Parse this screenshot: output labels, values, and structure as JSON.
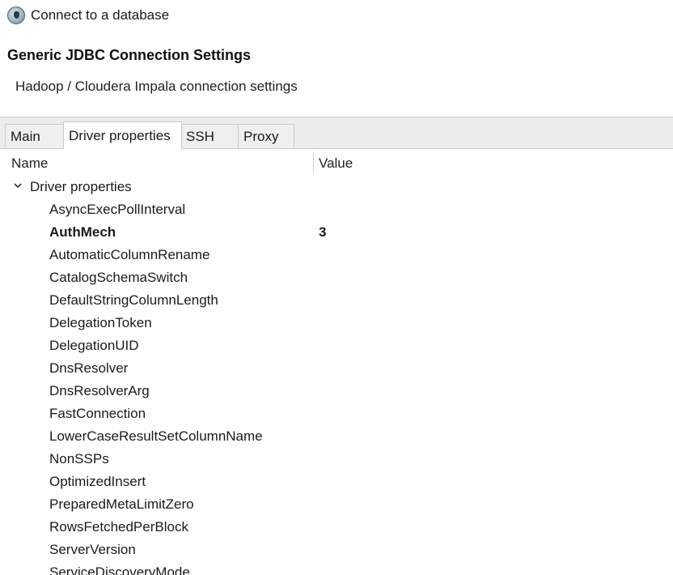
{
  "window": {
    "title": "Connect to a database",
    "icon": "database-connection-icon"
  },
  "header": {
    "title": "Generic JDBC Connection Settings",
    "subtitle": "Hadoop / Cloudera Impala connection settings"
  },
  "tabs": [
    {
      "label": "Main",
      "active": false
    },
    {
      "label": "Driver properties",
      "active": true
    },
    {
      "label": "SSH",
      "active": false
    },
    {
      "label": "Proxy",
      "active": false
    }
  ],
  "table": {
    "columns": {
      "name": "Name",
      "value": "Value"
    },
    "group": {
      "label": "Driver properties",
      "expanded": true
    },
    "rows": [
      {
        "name": "AsyncExecPollInterval",
        "value": ""
      },
      {
        "name": "AuthMech",
        "value": "3"
      },
      {
        "name": "AutomaticColumnRename",
        "value": ""
      },
      {
        "name": "CatalogSchemaSwitch",
        "value": ""
      },
      {
        "name": "DefaultStringColumnLength",
        "value": ""
      },
      {
        "name": "DelegationToken",
        "value": ""
      },
      {
        "name": "DelegationUID",
        "value": ""
      },
      {
        "name": "DnsResolver",
        "value": ""
      },
      {
        "name": "DnsResolverArg",
        "value": ""
      },
      {
        "name": "FastConnection",
        "value": ""
      },
      {
        "name": "LowerCaseResultSetColumnName",
        "value": ""
      },
      {
        "name": "NonSSPs",
        "value": ""
      },
      {
        "name": "OptimizedInsert",
        "value": ""
      },
      {
        "name": "PreparedMetaLimitZero",
        "value": ""
      },
      {
        "name": "RowsFetchedPerBlock",
        "value": ""
      },
      {
        "name": "ServerVersion",
        "value": ""
      },
      {
        "name": "ServiceDiscoveryMode",
        "value": ""
      }
    ]
  }
}
